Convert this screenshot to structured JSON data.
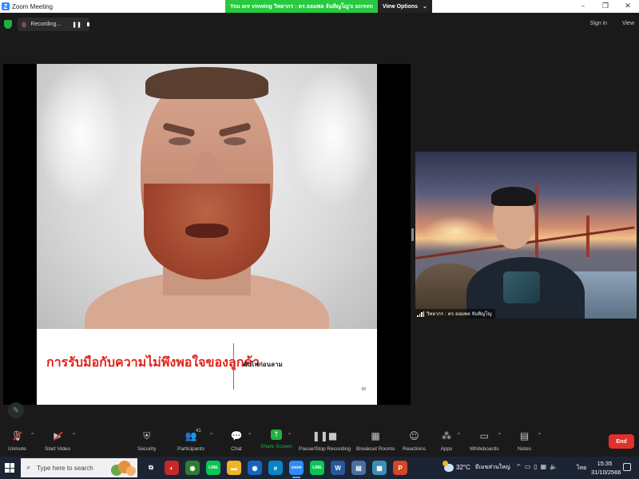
{
  "window": {
    "title": "Zoom Meeting",
    "logo_letter": "Z",
    "controls": [
      "–",
      "❐",
      "✕"
    ]
  },
  "share_banner": {
    "text": "You are viewing วิทยากร : ดร.จอมพล จันทิญโญ's screen",
    "view_options": "View Options",
    "caret": "⌄"
  },
  "recording": {
    "label": "Recording...",
    "pause": "❚❚"
  },
  "top_right": {
    "signin": "Sign in",
    "view": "View"
  },
  "slide": {
    "caption_main": "การรับมือกับความไม่พึงพอใจของลูกค้า",
    "caption_sub": "ดับไฟก่อนลาม",
    "page_num": "08"
  },
  "video": {
    "participant_name": "วิทยากร : ดร.จอมพล จันทิญโญ"
  },
  "toolbar": {
    "unmute": "Unmute",
    "start_video": "Start Video",
    "security": "Security",
    "participants": "Participants",
    "participants_count": "41",
    "chat": "Chat",
    "share_screen": "Share Screen",
    "pause_stop_recording": "Pause/Stop Recording",
    "breakout_rooms": "Breakout Rooms",
    "reactions": "Reactions",
    "apps": "Apps",
    "whiteboards": "Whiteboards",
    "notes": "Notes",
    "end": "End",
    "caret": "^"
  },
  "taskbar": {
    "search_placeholder": "Type here to search",
    "apps": [
      {
        "name": "task-view",
        "label": "⧉",
        "color": "#1c2433"
      },
      {
        "name": "app-red-circle",
        "label": "◐",
        "color": "#c62828"
      },
      {
        "name": "chrome",
        "label": "◉",
        "color": "#2e7d32"
      },
      {
        "name": "line",
        "label": "LINE",
        "color": "#06c755"
      },
      {
        "name": "file-explorer",
        "label": "▬",
        "color": "#f0b429"
      },
      {
        "name": "chrome-2",
        "label": "◉",
        "color": "#1565c0"
      },
      {
        "name": "edge",
        "label": "e",
        "color": "#0a84c6"
      },
      {
        "name": "zoom",
        "label": "zoom",
        "color": "#2d8cff"
      },
      {
        "name": "line-2",
        "label": "LINE",
        "color": "#06c755"
      },
      {
        "name": "word",
        "label": "W",
        "color": "#2b579a"
      },
      {
        "name": "app-blue",
        "label": "▤",
        "color": "#4a6fa5"
      },
      {
        "name": "app-teal",
        "label": "▦",
        "color": "#3a8fb7"
      },
      {
        "name": "powerpoint",
        "label": "P",
        "color": "#d24726"
      }
    ],
    "weather_temp": "32°C",
    "weather_desc": "มีเมฆส่วนใหญ่",
    "tray_icons": [
      "^",
      "▭",
      "▯",
      "▦",
      "🔈"
    ],
    "language": "ไทย",
    "time": "15:35",
    "date": "31/10/2566"
  },
  "colors": {
    "accent_green": "#1fb141",
    "end_red": "#e0312a",
    "caption_red": "#e2231a",
    "zoom_blue": "#2d8cff"
  },
  "icons": {
    "shield": "shield-icon",
    "annotate": "pencil-icon",
    "search": "search-icon",
    "start": "windows-start-icon"
  }
}
